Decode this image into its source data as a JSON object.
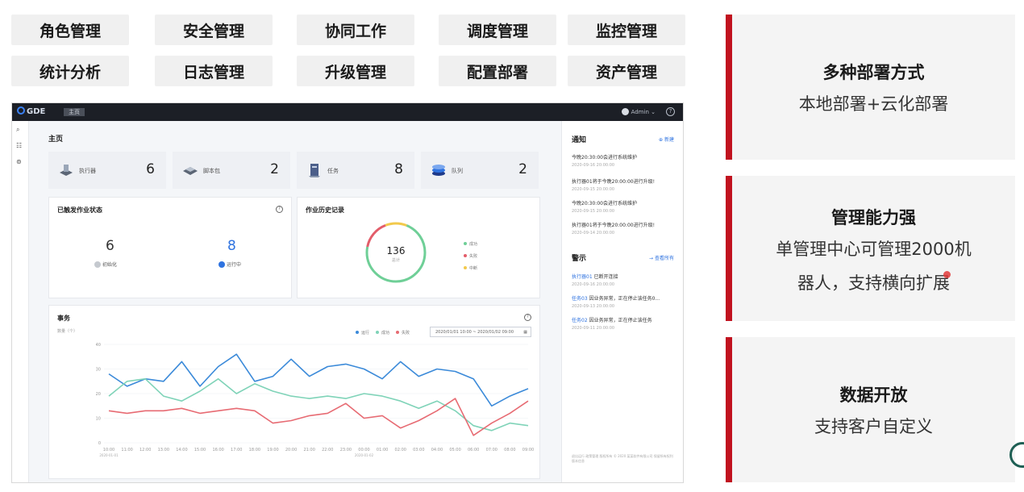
{
  "features": [
    {
      "label": "角色管理"
    },
    {
      "label": "安全管理"
    },
    {
      "label": "协同工作"
    },
    {
      "label": "调度管理"
    },
    {
      "label": "监控管理"
    },
    {
      "label": "统计分析"
    },
    {
      "label": "日志管理"
    },
    {
      "label": "升级管理"
    },
    {
      "label": "配置部署"
    },
    {
      "label": "资产管理"
    }
  ],
  "app": {
    "logo": "GDE",
    "home_tab": "主页",
    "admin": "Admin",
    "page_title": "主页",
    "stats": [
      {
        "label": "执行器",
        "value": "6",
        "icon": "executor-icon"
      },
      {
        "label": "脚本包",
        "value": "2",
        "icon": "script-package-icon"
      },
      {
        "label": "任务",
        "value": "8",
        "icon": "task-icon"
      },
      {
        "label": "队列",
        "value": "2",
        "icon": "queue-icon"
      }
    ],
    "job_status": {
      "title": "已触发作业状态",
      "items": [
        {
          "value": "6",
          "label": "初始化",
          "color": "#9aa0a6"
        },
        {
          "value": "8",
          "label": "运行中",
          "color": "#2f73e0"
        }
      ]
    },
    "history": {
      "title": "作业历史记录",
      "total": "136",
      "total_label": "总计",
      "legend": [
        {
          "label": "成功",
          "color": "#6fcf97"
        },
        {
          "label": "失败",
          "color": "#e35d6a"
        },
        {
          "label": "中断",
          "color": "#f2c94c"
        }
      ],
      "ring": {
        "success": 0.72,
        "failed": 0.16,
        "interrupted": 0.12
      }
    },
    "affairs": {
      "title": "事务",
      "unit": "数量（个）",
      "date_range": "2020/01/01 10:00  ~  2020/01/02 09:00",
      "legend": [
        {
          "label": "运行",
          "color": "#3b8ad9"
        },
        {
          "label": "成功",
          "color": "#7fd3b8"
        },
        {
          "label": "失败",
          "color": "#e76b73"
        }
      ]
    },
    "notices_title": "通知",
    "notices_link": "新建",
    "notices": [
      {
        "text": "今晚20:30:00会进行系统维护",
        "date": "2020-09-16 20:00:00"
      },
      {
        "text": "执行器01将于今晚20:00:00进行升级!",
        "date": "2020-09-15 20:00:00"
      },
      {
        "text": "今晚20:30:00会进行系统维护",
        "date": "2020-09-15 20:00:00"
      },
      {
        "text": "执行器01将于今晚20:00:00进行升级!",
        "date": "2020-09-14 20:00:00"
      }
    ],
    "alerts_title": "警示",
    "alerts_link": "查看所有",
    "alerts": [
      {
        "key": "执行器01",
        "text": "已断开连接",
        "date": "2020-09-16 20:00:00"
      },
      {
        "key": "任务03",
        "text": "因业务异常，正在停止该任务0...",
        "date": "2020-09-13 20:00:00"
      },
      {
        "key": "任务02",
        "text": "因业务异常，正在停止该任务",
        "date": "2020-09-11 20:00:00"
      }
    ],
    "footer_note": "退出运行 政策管理 版权所有 © 2020 某某软件有限公司 保留所有权利 版本信息"
  },
  "chart_data": {
    "type": "line",
    "title": "事务",
    "ylabel": "数量（个）",
    "ylim": [
      0,
      40
    ],
    "yticks": [
      0,
      10,
      20,
      30,
      40
    ],
    "x": [
      "10:00",
      "11:00",
      "12:00",
      "13:00",
      "14:00",
      "15:00",
      "16:00",
      "17:00",
      "18:00",
      "19:00",
      "20:00",
      "21:00",
      "22:00",
      "23:00",
      "00:00",
      "01:00",
      "02:00",
      "03:00",
      "04:00",
      "05:00",
      "06:00",
      "07:00",
      "08:00",
      "09:00"
    ],
    "x_sublabels": {
      "0": "2020-01-01",
      "14": "2020-01-02"
    },
    "series": [
      {
        "name": "运行",
        "color": "#3b8ad9",
        "values": [
          28,
          23,
          26,
          25,
          33,
          23,
          31,
          36,
          25,
          27,
          34,
          27,
          31,
          32,
          30,
          26,
          33,
          27,
          30,
          29,
          26,
          15,
          19,
          22
        ]
      },
      {
        "name": "成功",
        "color": "#7fd3b8",
        "values": [
          19,
          25,
          26,
          19,
          17,
          21,
          26,
          20,
          24,
          21,
          19,
          18,
          19,
          18,
          20,
          19,
          17,
          14,
          17,
          13,
          7,
          5,
          8,
          7
        ]
      },
      {
        "name": "失败",
        "color": "#e76b73",
        "values": [
          13,
          12,
          13,
          13,
          14,
          12,
          13,
          14,
          13,
          8,
          9,
          11,
          12,
          16,
          10,
          11,
          6,
          9,
          13,
          18,
          3,
          8,
          12,
          17
        ]
      }
    ]
  },
  "feature_cards": [
    {
      "title": "多种部署方式",
      "desc": [
        "本地部署+云化部署"
      ]
    },
    {
      "title": "管理能力强",
      "desc": [
        "单管理中心可管理2000机",
        "器人，支持横向扩展"
      ]
    },
    {
      "title": "数据开放",
      "desc": [
        "支持客户自定义"
      ]
    }
  ]
}
